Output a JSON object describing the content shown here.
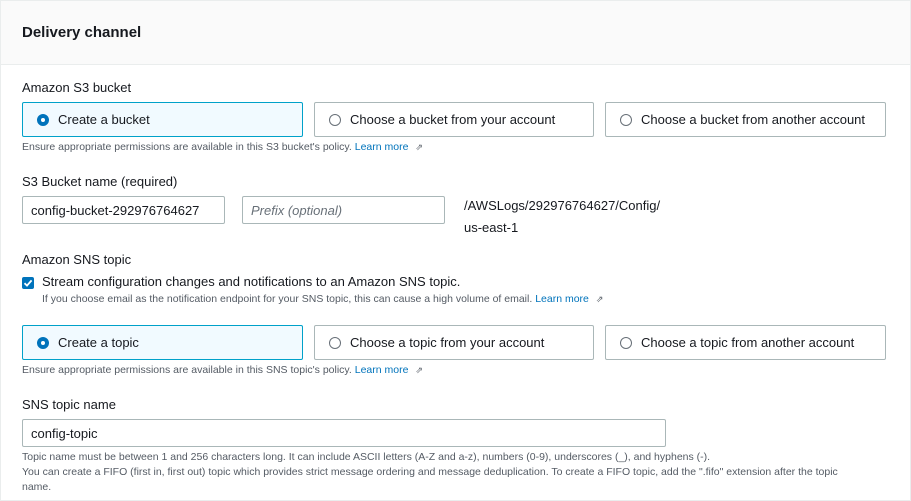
{
  "section": {
    "title": "Delivery channel"
  },
  "s3": {
    "label": "Amazon S3 bucket",
    "options": [
      {
        "label": "Create a bucket",
        "selected": true
      },
      {
        "label": "Choose a bucket from your account",
        "selected": false
      },
      {
        "label": "Choose a bucket from another account",
        "selected": false
      }
    ],
    "help": "Ensure appropriate permissions are available in this S3 bucket's policy.",
    "help_link": "Learn more"
  },
  "bucket_name": {
    "label": "S3 Bucket name (required)",
    "value": "config-bucket-292976764627",
    "prefix_placeholder": "Prefix (optional)",
    "path_line1": "/AWSLogs/292976764627/Config/",
    "path_line2": "us-east-1"
  },
  "sns": {
    "label": "Amazon SNS topic",
    "checkbox_label": "Stream configuration changes and notifications to an Amazon SNS topic.",
    "checkbox_checked": true,
    "checkbox_help": "If you choose email as the notification endpoint for your SNS topic, this can cause a high volume of email.",
    "checkbox_help_link": "Learn more",
    "options": [
      {
        "label": "Create a topic",
        "selected": true
      },
      {
        "label": "Choose a topic from your account",
        "selected": false
      },
      {
        "label": "Choose a topic from another account",
        "selected": false
      }
    ],
    "help": "Ensure appropriate permissions are available in this SNS topic's policy.",
    "help_link": "Learn more"
  },
  "topic_name": {
    "label": "SNS topic name",
    "value": "config-topic",
    "help_line1": "Topic name must be between 1 and 256 characters long. It can include ASCII letters (A-Z and a-z), numbers (0-9), underscores (_), and hyphens (-).",
    "help_line2": "You can create a FIFO (first in, first out) topic which provides strict message ordering and message deduplication. To create a FIFO topic, add the \".fifo\" extension after the topic",
    "help_line3": "name."
  },
  "icons": {
    "external": "external-link-icon",
    "check": "checkmark-icon"
  },
  "colors": {
    "accent": "#0073bb",
    "selected_border": "#00a1c9",
    "selected_bg": "#f1faff"
  }
}
